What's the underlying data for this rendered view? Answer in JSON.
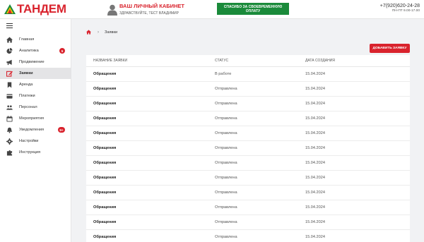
{
  "brand": {
    "name": "ТАНДЕМ",
    "color": "#d9232d"
  },
  "header": {
    "cabinet_title": "ВАШ ЛИЧНЫЙ КАБИНЕТ",
    "greeting": "ЗДРАВСТВУЙТЕ, ТЕСТ ВЛАДИМИР",
    "thanks_button": "СПАСИБО ЗА СВОЕВРЕМЕННУЮ ОПЛАТУ",
    "phone": "+7(920)620-24-28",
    "hours": "ПН-ПТ 9.00-17.00"
  },
  "sidebar": {
    "items": [
      {
        "label": "Главная",
        "icon": "home-icon",
        "active": false,
        "badge": null
      },
      {
        "label": "Аналитика",
        "icon": "pie-chart-icon",
        "active": false,
        "badge": "5"
      },
      {
        "label": "Продвижение",
        "icon": "megaphone-icon",
        "active": false,
        "badge": null
      },
      {
        "label": "Заявки",
        "icon": "edit-icon",
        "active": true,
        "badge": null
      },
      {
        "label": "Аренда",
        "icon": "bookmark-icon",
        "active": false,
        "badge": null
      },
      {
        "label": "Платежи",
        "icon": "card-icon",
        "active": false,
        "badge": null
      },
      {
        "label": "Персонал",
        "icon": "people-icon",
        "active": false,
        "badge": null
      },
      {
        "label": "Мероприятия",
        "icon": "calendar-icon",
        "active": false,
        "badge": null
      },
      {
        "label": "Уведомления",
        "icon": "bell-icon",
        "active": false,
        "badge": "9+"
      },
      {
        "label": "Настройки",
        "icon": "gear-icon",
        "active": false,
        "badge": null
      },
      {
        "label": "Инструкция",
        "icon": "puzzle-icon",
        "active": false,
        "badge": null
      }
    ]
  },
  "breadcrumb": {
    "current": "Заявки"
  },
  "actions": {
    "add_label": "ДОБАВИТЬ ЗАЯВКУ"
  },
  "table": {
    "columns": [
      "НАЗВАНИЕ ЗАЯВКИ",
      "СТАТУС",
      "ДАТА СОЗДАНИЯ"
    ],
    "rows": [
      [
        "Обращения",
        "В работе",
        "15.04.2024"
      ],
      [
        "Обращения",
        "Отправлена",
        "15.04.2024"
      ],
      [
        "Обращения",
        "Отправлена",
        "15.04.2024"
      ],
      [
        "Обращения",
        "Отправлена",
        "15.04.2024"
      ],
      [
        "Обращения",
        "Отправлена",
        "15.04.2024"
      ],
      [
        "Обращения",
        "Отправлена",
        "15.04.2024"
      ],
      [
        "Обращения",
        "Отправлена",
        "15.04.2024"
      ],
      [
        "Обращения",
        "Отправлена",
        "15.04.2024"
      ],
      [
        "Обращения",
        "Отправлена",
        "15.04.2024"
      ],
      [
        "Обращения",
        "Отправлена",
        "15.04.2024"
      ],
      [
        "Обращения",
        "Отправлена",
        "15.04.2024"
      ],
      [
        "Обращения",
        "Отправлена",
        "15.04.2024"
      ]
    ]
  }
}
